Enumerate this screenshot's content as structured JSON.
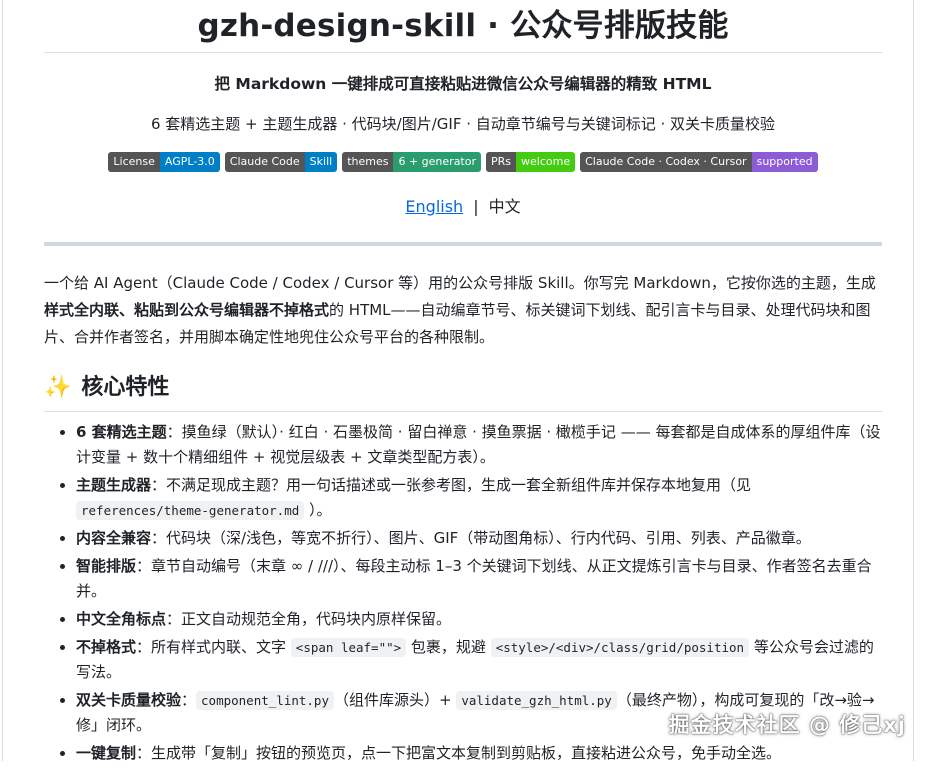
{
  "title": "gzh-design-skill · 公众号排版技能",
  "tagline": "把 Markdown 一键排成可直接粘贴进微信公众号编辑器的精致 HTML",
  "features_line": "6 套精选主题 + 主题生成器 · 代码块/图片/GIF · 自动章节编号与关键词标记 · 双关卡质量校验",
  "badges": [
    {
      "label": "License",
      "value": "AGPL-3.0",
      "color": "#007ec6"
    },
    {
      "label": "Claude Code",
      "value": "Skill",
      "color": "#007ec6"
    },
    {
      "label": "themes",
      "value": "6 + generator",
      "color": "#2a9d6f"
    },
    {
      "label": "PRs",
      "value": "welcome",
      "color": "#4c1"
    },
    {
      "label": "Claude Code · Codex · Cursor",
      "value": "supported",
      "color": "#8c5bd6"
    }
  ],
  "lang": {
    "english": "English",
    "sep": "|",
    "chinese": "中文"
  },
  "intro": {
    "p1": "一个给 AI Agent（Claude Code / Codex / Cursor 等）用的公众号排版 Skill。你写完 Markdown，它按你选的主题，生成",
    "bold": "样式全内联、粘贴到公众号编辑器不掉格式",
    "p2": "的 HTML——自动编章节号、标关键词下划线、配引言卡与目录、处理代码块和图片、合并作者签名，并用脚本确定性地兜住公众号平台的各种限制。"
  },
  "section_icon": "sparkles-icon",
  "section_title": "核心特性",
  "features": [
    {
      "bold": "6 套精选主题",
      "text": "：摸鱼绿（默认）· 红白 · 石墨极简 · 留白禅意 · 摸鱼票据 · 橄榄手记 —— 每套都是自成体系的厚组件库（设计变量 + 数十个精细组件 + 视觉层级表 + 文章类型配方表）。"
    },
    {
      "bold": "主题生成器",
      "text": "：不满足现成主题？用一句话描述或一张参考图，生成一套全新组件库并保存本地复用（见 ",
      "code": "references/theme-generator.md",
      "after": " ）。"
    },
    {
      "bold": "内容全兼容",
      "text": "：代码块（深/浅色，等宽不折行）、图片、GIF（带动图角标）、行内代码、引用、列表、产品徽章。"
    },
    {
      "bold": "智能排版",
      "text": "：章节自动编号（末章 ∞ / ///）、每段主动标 1–3 个关键词下划线、从正文提炼引言卡与目录、作者签名去重合并。"
    },
    {
      "bold": "中文全角标点",
      "text": "：正文自动规范全角，代码块内原样保留。"
    },
    {
      "bold": "不掉格式",
      "text": "：所有样式内联、文字 ",
      "code": "<span leaf=\"\">",
      "mid": " 包裹，规避 ",
      "code2": "<style>/<div>/class/grid/position",
      "after": " 等公众号会过滤的写法。"
    },
    {
      "bold": "双关卡质量校验",
      "text": "：",
      "code": "component_lint.py",
      "mid": "（组件库源头）+ ",
      "code2": "validate_gzh_html.py",
      "after": "（最终产物），构成可复现的「改→验→修」闭环。"
    },
    {
      "bold": "一键复制",
      "text": "：生成带「复制」按钮的预览页，点一下把富文本复制到剪贴板，直接粘进公众号，免手动全选。"
    }
  ],
  "watermark": "掘金技术社区 @ 修己xj"
}
